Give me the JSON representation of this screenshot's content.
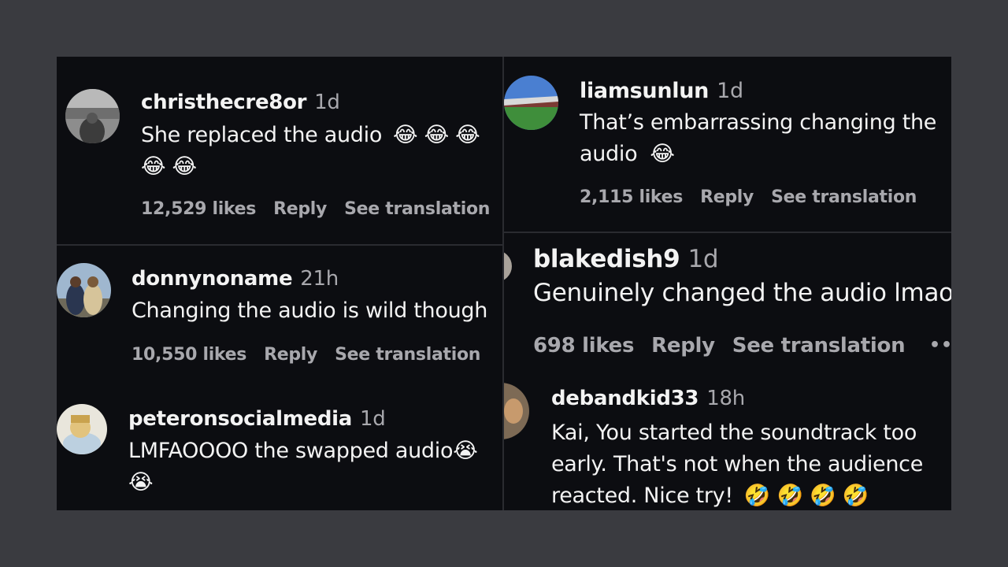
{
  "comments": [
    {
      "username": "christhecre8or",
      "time": "1d",
      "text": "She replaced the audio",
      "emoji_line1": "😂 😂 😂",
      "emoji_line2": "😂 😂",
      "likes": "12,529 likes",
      "reply": "Reply",
      "translate": "See translation"
    },
    {
      "username": "liamsunlun",
      "time": "1d",
      "text_line1": "That’s embarrassing changing the",
      "text_line2": "audio",
      "emoji": "😂",
      "likes": "2,115 likes",
      "reply": "Reply",
      "translate": "See translation"
    },
    {
      "username": "donnynoname",
      "time": "21h",
      "text": "Changing the audio is wild though",
      "likes": "10,550 likes",
      "reply": "Reply",
      "translate": "See translation"
    },
    {
      "username": "blakedish9",
      "time": "1d",
      "text": "Genuinely changed the audio lmao",
      "likes": "698 likes",
      "reply": "Reply",
      "translate": "See translation",
      "more": "••"
    },
    {
      "username": "peteronsocialmedia",
      "time": "1d",
      "text": "LMFAOOOO the swapped audio",
      "emoji_line1": "😭",
      "emoji_line2": "😭"
    },
    {
      "username": "debandkid33",
      "time": "18h",
      "text_line1": "Kai, You started the soundtrack too",
      "text_line2": "early. That's not when the audience",
      "text_line3": "reacted. Nice try!",
      "emoji": "🤣 🤣 🤣 🤣"
    }
  ]
}
